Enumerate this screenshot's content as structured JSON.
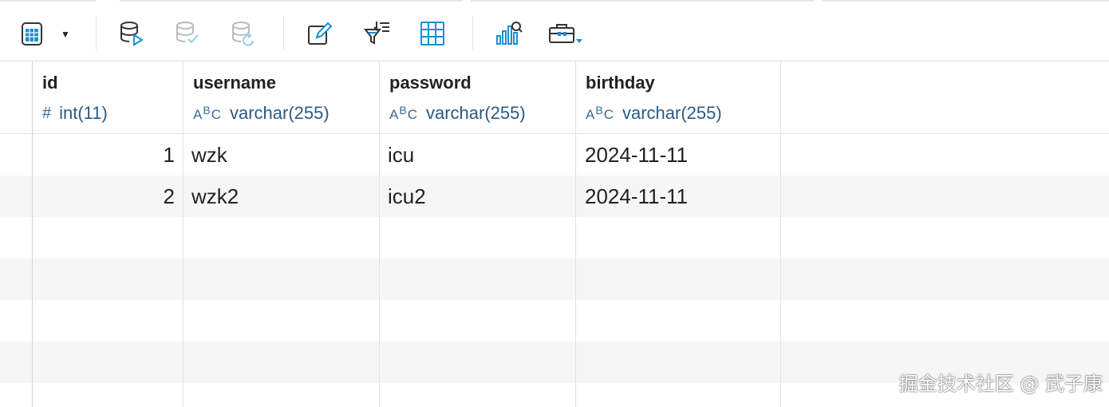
{
  "toolbar": {
    "buttons": [
      {
        "icon": "calculator-icon"
      },
      {
        "icon": "database-run-icon"
      },
      {
        "icon": "database-check-icon"
      },
      {
        "icon": "database-revert-icon"
      },
      {
        "icon": "pencil-icon"
      },
      {
        "icon": "filter-sort-icon"
      },
      {
        "icon": "grid-icon"
      },
      {
        "icon": "chart-search-icon"
      },
      {
        "icon": "toolbox-icon"
      }
    ]
  },
  "table": {
    "columns": [
      {
        "name": "id",
        "type": "int(11)"
      },
      {
        "name": "username",
        "type": "varchar(255)"
      },
      {
        "name": "password",
        "type": "varchar(255)"
      },
      {
        "name": "birthday",
        "type": "varchar(255)"
      }
    ],
    "rows": [
      [
        "1",
        "wzk",
        "icu",
        "2024-11-11"
      ],
      [
        "2",
        "wzk2",
        "icu2",
        "2024-11-11"
      ]
    ]
  },
  "watermark": "掘金技术社区 @ 武子康",
  "colors": {
    "accent": "#1a8fd6",
    "type_text": "#2a5b85",
    "header_bg": "#ffffff",
    "alt_row": "#f6f6f6"
  }
}
